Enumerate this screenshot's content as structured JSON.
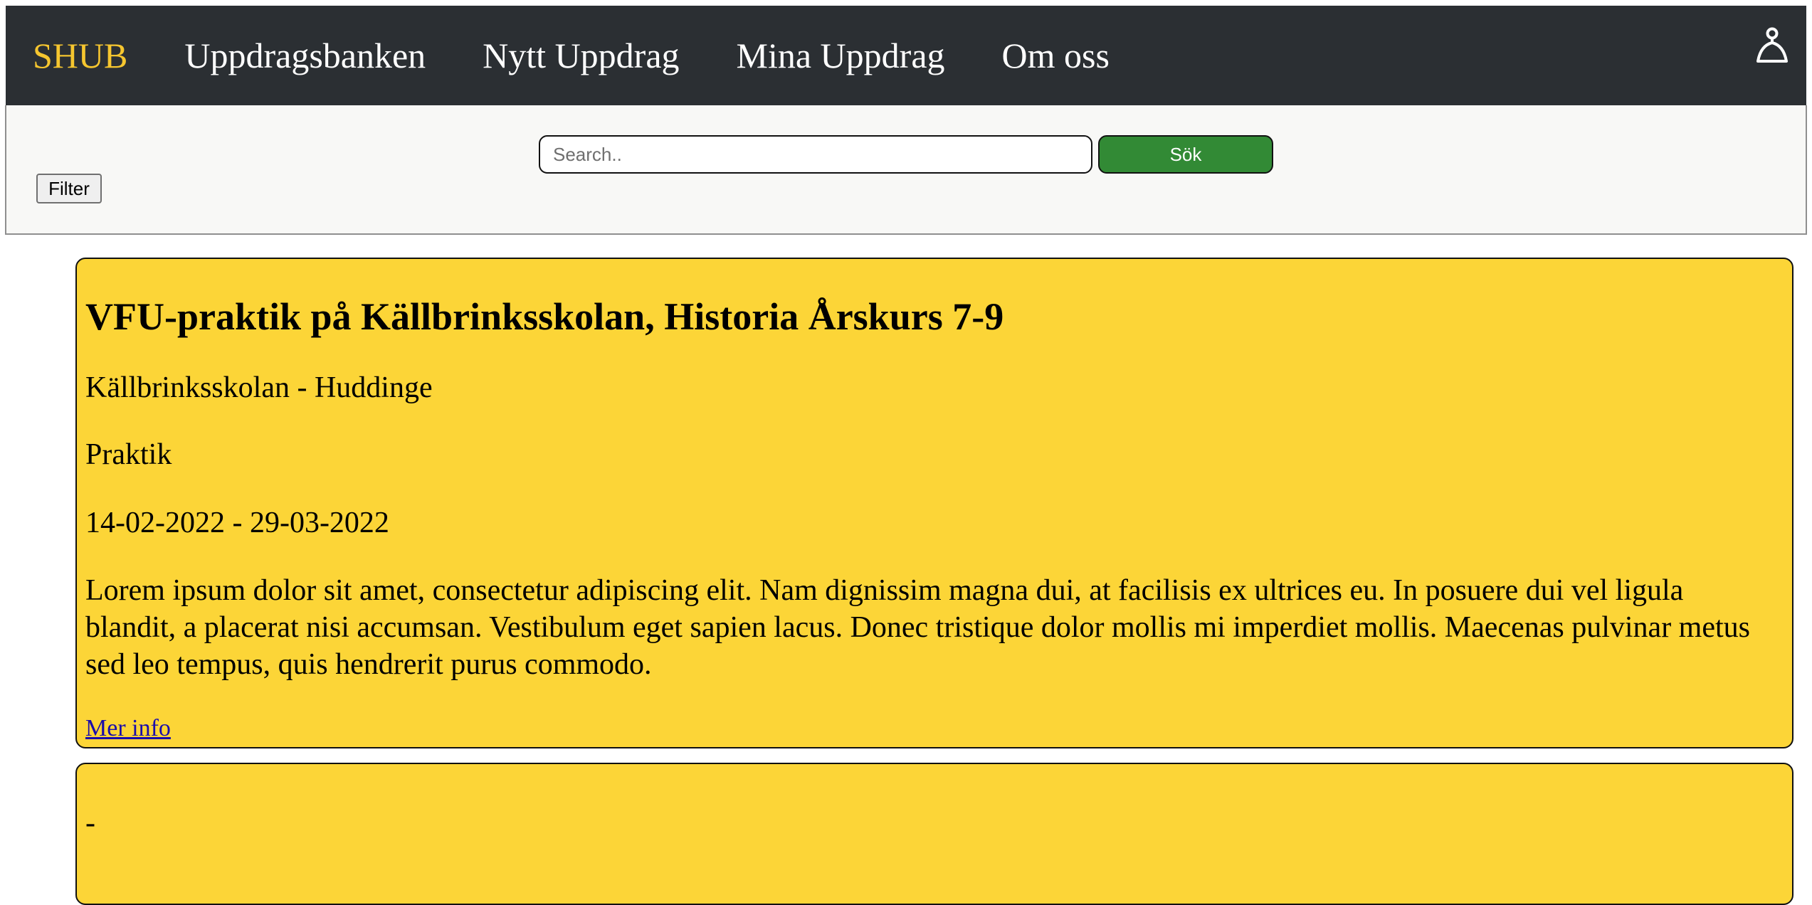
{
  "navbar": {
    "brand": "SHUB",
    "links": [
      "Uppdragsbanken",
      "Nytt Uppdrag",
      "Mina Uppdrag",
      "Om oss"
    ],
    "user_icon": "user-icon",
    "colors": {
      "background": "#2b2f33",
      "brand": "#f6c62f",
      "link": "#ffffff"
    }
  },
  "toolbar": {
    "search_placeholder": "Search..",
    "search_value": "",
    "search_button": "Sök",
    "filter_button": "Filter",
    "colors": {
      "search_button": "#328a35"
    }
  },
  "assignments": [
    {
      "title": "VFU-praktik på Källbrinksskolan, Historia Årskurs 7-9",
      "school": "Källbrinksskolan - Huddinge",
      "type": "Praktik",
      "dates": "14-02-2022 - 29-03-2022",
      "description": "Lorem ipsum dolor sit amet, consectetur adipiscing elit. Nam dignissim magna dui, at facilisis ex ultrices eu. In posuere dui vel ligula blandit, a placerat nisi accumsan. Vestibulum eget sapien lacus. Donec tristique dolor mollis mi imperdiet mollis. Maecenas pulvinar metus sed leo tempus, quis hendrerit purus commodo.",
      "link": "Mer info"
    },
    {
      "text": "-"
    }
  ],
  "colors": {
    "card_background": "#fcd537",
    "link": "#1a0dab"
  }
}
